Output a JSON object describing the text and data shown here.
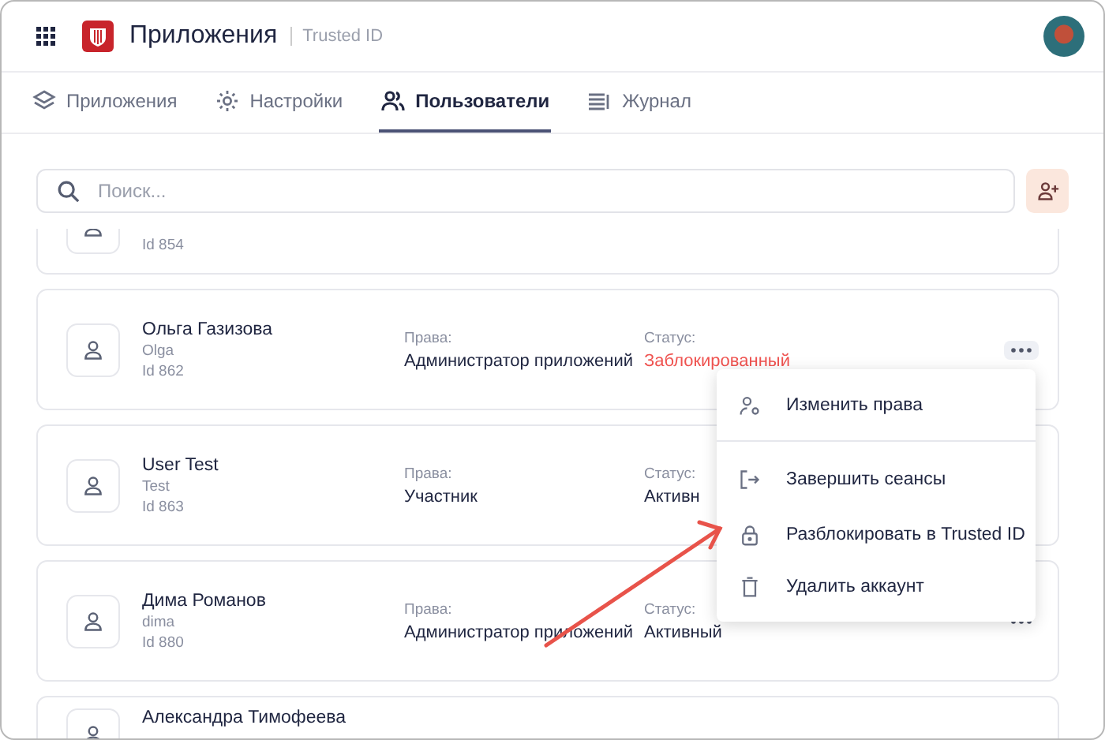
{
  "header": {
    "title": "Приложения",
    "subtitle": "Trusted ID"
  },
  "tabs": [
    {
      "label": "Приложения",
      "selected": false
    },
    {
      "label": "Настройки",
      "selected": false
    },
    {
      "label": "Пользователи",
      "selected": true
    },
    {
      "label": "Журнал",
      "selected": false
    }
  ],
  "search": {
    "placeholder": "Поиск..."
  },
  "users": [
    {
      "id": "Id 854"
    },
    {
      "name": "Ольга Газизова",
      "login": "Olga",
      "id": "Id 862",
      "rights_label": "Права:",
      "rights": "Администратор приложений",
      "status_label": "Статус:",
      "status": "Заблокированный",
      "blocked": true,
      "menu_open": true
    },
    {
      "name": "User Test",
      "login": "Test",
      "id": "Id 863",
      "rights_label": "Права:",
      "rights": "Участник",
      "status_label": "Статус:",
      "status": "Активн",
      "blocked": false,
      "menu_open": false
    },
    {
      "name": "Дима Романов",
      "login": "dima",
      "id": "Id 880",
      "rights_label": "Права:",
      "rights": "Администратор приложений",
      "status_label": "Статус:",
      "status": "Активный",
      "blocked": false,
      "menu_open": false
    },
    {
      "name": "Александра Тимофеева"
    }
  ],
  "menu": [
    {
      "label": "Изменить права",
      "divider_before": false
    },
    {
      "label": "Завершить сеансы",
      "divider_before": true
    },
    {
      "label": "Разблокировать в Trusted ID",
      "divider_before": false
    },
    {
      "label": "Удалить аккаунт",
      "divider_before": false
    }
  ]
}
